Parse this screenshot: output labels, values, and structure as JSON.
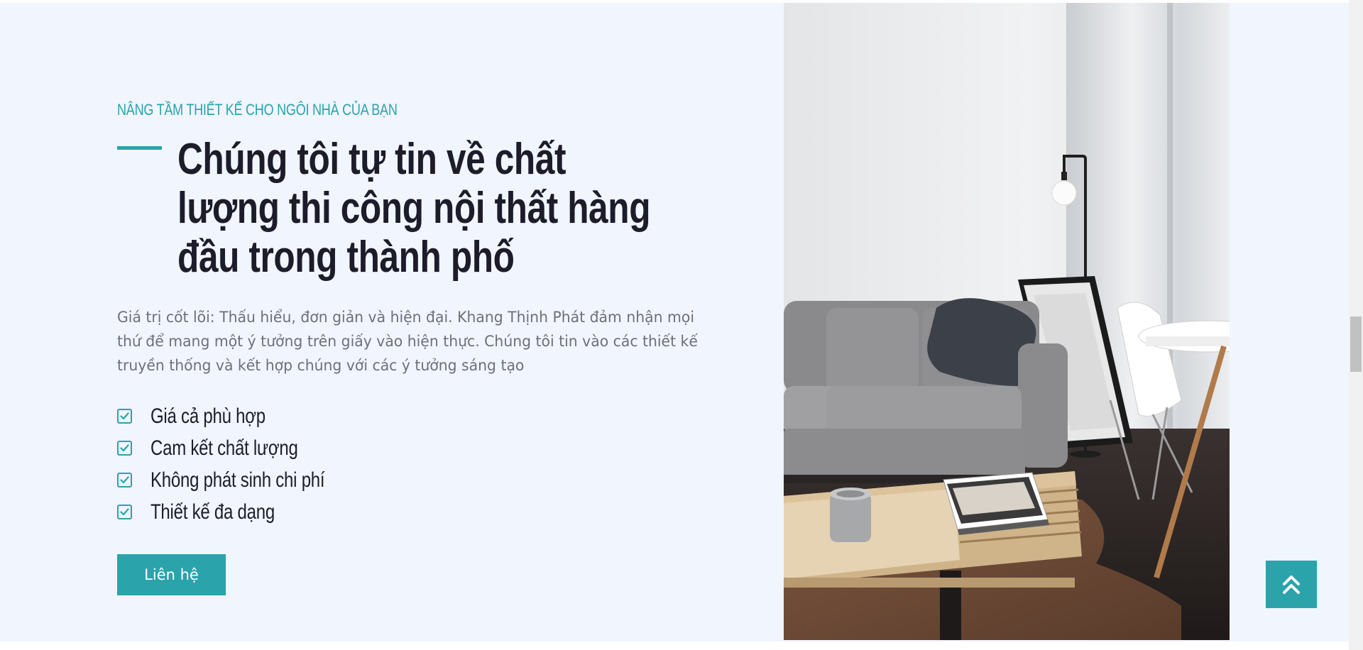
{
  "about": {
    "subtitle": "NÂNG TẦM THIẾT KẾ CHO NGÔI NHÀ CỦA BẠN",
    "heading": "Chúng tôi tự tin về chất lượng thi công nội thất hàng đầu trong thành phố",
    "description": "Giá trị cốt lõi: Thấu hiểu, đơn giản và hiện đại. Khang Thịnh Phát đảm nhận mọi thứ để mang một ý tưởng trên giấy vào hiện thực. Chúng tôi tin vào các thiết kế truyền thống và kết hợp chúng với các ý tưởng sáng tạo",
    "features": [
      {
        "label": "Giá cả phù hợp",
        "icon": "checkbox-icon"
      },
      {
        "label": "Cam kết chất lượng",
        "icon": "checkbox-icon"
      },
      {
        "label": "Không phát sinh chi phí",
        "icon": "checkbox-icon"
      },
      {
        "label": "Thiết kế đa dạng",
        "icon": "checkbox-icon"
      }
    ],
    "cta_label": "Liên hệ",
    "image": "living-room-photo"
  },
  "scroll_top": {
    "icon": "double-chevron-up-icon"
  },
  "colors": {
    "accent": "#2aa3ab",
    "background": "#f1f5fe",
    "heading": "#1d1c2a",
    "text": "#6f6f78"
  }
}
